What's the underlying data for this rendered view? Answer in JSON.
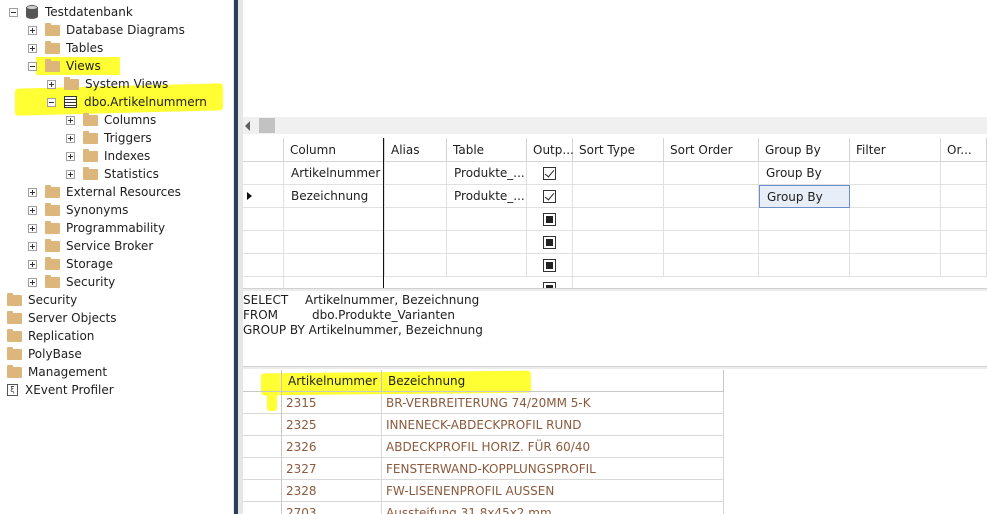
{
  "explorer": {
    "database": "Testdatenbank",
    "items": [
      {
        "label": "Database Diagrams"
      },
      {
        "label": "Tables"
      },
      {
        "label": "Views"
      },
      {
        "label": "System Views"
      },
      {
        "label": "dbo.Artikelnummern"
      },
      {
        "label": "Columns"
      },
      {
        "label": "Triggers"
      },
      {
        "label": "Indexes"
      },
      {
        "label": "Statistics"
      },
      {
        "label": "External Resources"
      },
      {
        "label": "Synonyms"
      },
      {
        "label": "Programmability"
      },
      {
        "label": "Service Broker"
      },
      {
        "label": "Storage"
      },
      {
        "label": "Security"
      }
    ],
    "server_items": [
      {
        "label": "Security"
      },
      {
        "label": "Server Objects"
      },
      {
        "label": "Replication"
      },
      {
        "label": "PolyBase"
      },
      {
        "label": "Management"
      },
      {
        "label": "XEvent Profiler"
      }
    ]
  },
  "criteria": {
    "headers": [
      "Column",
      "Alias",
      "Table",
      "Outp...",
      "Sort Type",
      "Sort Order",
      "Group By",
      "Filter",
      "Or..."
    ],
    "rows": [
      {
        "column": "Artikelnummer",
        "table": "Produkte_...",
        "output": "checked",
        "group_by": "Group By"
      },
      {
        "column": "Bezeichnung",
        "table": "Produkte_...",
        "output": "checked",
        "group_by": "Group By"
      },
      {
        "column": "",
        "table": "",
        "output": "indeterminate",
        "group_by": ""
      },
      {
        "column": "",
        "table": "",
        "output": "indeterminate",
        "group_by": ""
      },
      {
        "column": "",
        "table": "",
        "output": "indeterminate",
        "group_by": ""
      }
    ]
  },
  "sql": {
    "select_kw": "SELECT",
    "select_cols": "Artikelnummer, Bezeichnung",
    "from_kw": "FROM",
    "from_table": "dbo.Produkte_Varianten",
    "group_line": "GROUP BY Artikelnummer, Bezeichnung"
  },
  "results": {
    "headers": [
      "Artikelnummer",
      "Bezeichnung"
    ],
    "rows": [
      {
        "nr": "2315",
        "bez": "BR-VERBREITERUNG 74/20MM 5-K"
      },
      {
        "nr": "2325",
        "bez": "INNENECK-ABDECKPROFIL RUND"
      },
      {
        "nr": "2326",
        "bez": "ABDECKPROFIL HORIZ. FÜR 60/40"
      },
      {
        "nr": "2327",
        "bez": "FENSTERWAND-KOPPLUNGSPROFIL"
      },
      {
        "nr": "2328",
        "bez": "FW-LISENENPROFIL AUSSEN"
      },
      {
        "nr": "2703",
        "bez": "Aussteifung 31,8x45x2 mm"
      }
    ]
  },
  "colors": {
    "highlight": "#ffff33",
    "folder": "#dcb67a",
    "result_text": "#8b5a3c",
    "splitter": "#2d3e57"
  }
}
